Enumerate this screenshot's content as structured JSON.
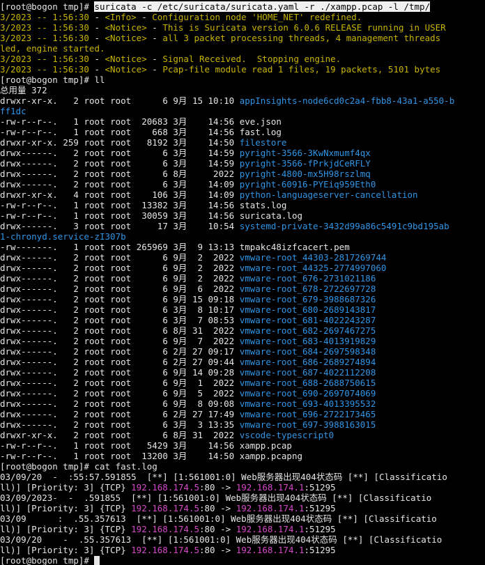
{
  "prompt": "[root@bogon tmp]# ",
  "command1": "suricata -c /etc/suricata/suricata.yaml -r ./xampp.pcap -l /tmp/",
  "suricata_output": [
    {
      "ts": "3/2023 -- 1:56:30",
      "tag": "<Info>",
      "msg": "Configuration node 'HOME_NET' redefined."
    },
    {
      "ts": "3/2023 -- 1:56:30",
      "tag": "<Notice>",
      "msg": "This is Suricata version 6.0.6 RELEASE running in USER"
    },
    {
      "ts": "3/2023 -- 1:56:30",
      "tag": "<Notice>",
      "msg": "all 3 packet processing threads, 4 management threads"
    },
    {
      "wrap": "led, engine started."
    },
    {
      "ts": "3/2023 -- 1:56:30",
      "tag": "<Notice>",
      "msg": "Signal Received.  Stopping engine."
    },
    {
      "ts": "3/2023 -- 1:56:30",
      "tag": "<Notice>",
      "msg": "Pcap-file module read 1 files, 19 packets, 5101 bytes"
    }
  ],
  "command2": "ll",
  "total_line": "总用量 372",
  "ls_rows": [
    {
      "perm": "drwxr-xr-x.",
      "links": "2",
      "size": "6",
      "month": "9月",
      "day": "15",
      "time": "10:10",
      "name": "appInsights-node6cd0c2a4-fbb8-43a1-a550-b",
      "dir": true
    },
    {
      "wrap": "ff1dc",
      "dir": true
    },
    {
      "perm": "-rw-r--r--.",
      "links": "1",
      "size": "20683",
      "month": "3月",
      "day": "",
      "time": "14:56",
      "name": "eve.json",
      "dir": false
    },
    {
      "perm": "-rw-r--r--.",
      "links": "1",
      "size": "668",
      "month": "3月",
      "day": "",
      "time": "14:56",
      "name": "fast.log",
      "dir": false
    },
    {
      "perm": "drwxr-xr-x.",
      "links": "259",
      "size": "8192",
      "month": "3月",
      "day": "",
      "time": "14:50",
      "name": "filestore",
      "dir": true
    },
    {
      "perm": "drwx------.",
      "links": "2",
      "size": "6",
      "month": "3月",
      "day": "",
      "time": "14:59",
      "name": "pyright-3566-3KwNxmumf4qx",
      "dir": true
    },
    {
      "perm": "drwx------.",
      "links": "2",
      "size": "6",
      "month": "3月",
      "day": "",
      "time": "14:59",
      "name": "pyright-3566-fPrkjdCeRFLY",
      "dir": true
    },
    {
      "perm": "drwx------.",
      "links": "2",
      "size": "6",
      "month": "8月",
      "day": "",
      "time": "2022",
      "name": "pyright-4800-mx5H98rszlmq",
      "dir": true
    },
    {
      "perm": "drwx------.",
      "links": "2",
      "size": "6",
      "month": "3月",
      "day": "",
      "time": "14:09",
      "name": "pyright-60916-PYEiq959Eth0",
      "dir": true
    },
    {
      "perm": "drwxr-xr-x.",
      "links": "4",
      "size": "106",
      "month": "3月",
      "day": "",
      "time": "14:09",
      "name": "python-languageserver-cancellation",
      "dir": true
    },
    {
      "perm": "-rw-r--r--.",
      "links": "1",
      "size": "13382",
      "month": "3月",
      "day": "",
      "time": "14:56",
      "name": "stats.log",
      "dir": false
    },
    {
      "perm": "-rw-r--r--.",
      "links": "1",
      "size": "30059",
      "month": "3月",
      "day": "",
      "time": "14:56",
      "name": "suricata.log",
      "dir": false
    },
    {
      "perm": "drwx------.",
      "links": "3",
      "size": "17",
      "month": "3月",
      "day": "",
      "time": "10:54",
      "name": "systemd-private-3432d99a86c5491c9bd195ab",
      "dir": true
    },
    {
      "wrap": "1-chronyd.service-zI307b",
      "dir": true
    },
    {
      "perm": "-rw-------.",
      "links": "1",
      "size": "265969",
      "month": "3月",
      "day": "9",
      "time": "13:13",
      "name": "tmpakc48izfcacert.pem",
      "dir": false
    },
    {
      "perm": "drwx------.",
      "links": "2",
      "size": "6",
      "month": "9月",
      "day": "2",
      "time": "2022",
      "name": "vmware-root_44303-2817269744",
      "dir": true
    },
    {
      "perm": "drwx------.",
      "links": "2",
      "size": "6",
      "month": "9月",
      "day": "2",
      "time": "2022",
      "name": "vmware-root_44325-2774997060",
      "dir": true
    },
    {
      "perm": "drwx------.",
      "links": "2",
      "size": "6",
      "month": "9月",
      "day": "2",
      "time": "2022",
      "name": "vmware-root_676-2731021186",
      "dir": true
    },
    {
      "perm": "drwx------.",
      "links": "2",
      "size": "6",
      "month": "9月",
      "day": "6",
      "time": "2022",
      "name": "vmware-root_678-2722697728",
      "dir": true
    },
    {
      "perm": "drwx------.",
      "links": "2",
      "size": "6",
      "month": "9月",
      "day": "15",
      "time": "09:18",
      "name": "vmware-root_679-3988687326",
      "dir": true
    },
    {
      "perm": "drwx------.",
      "links": "2",
      "size": "6",
      "month": "3月",
      "day": "8",
      "time": "10:17",
      "name": "vmware-root_680-2689143817",
      "dir": true
    },
    {
      "perm": "drwx------.",
      "links": "2",
      "size": "6",
      "month": "3月",
      "day": "7",
      "time": "08:53",
      "name": "vmware-root_681-4022243287",
      "dir": true
    },
    {
      "perm": "drwx------.",
      "links": "2",
      "size": "6",
      "month": "8月",
      "day": "31",
      "time": "2022",
      "name": "vmware-root_682-2697467275",
      "dir": true
    },
    {
      "perm": "drwx------.",
      "links": "2",
      "size": "6",
      "month": "9月",
      "day": "7",
      "time": "2022",
      "name": "vmware-root_683-4013919829",
      "dir": true
    },
    {
      "perm": "drwx------.",
      "links": "2",
      "size": "6",
      "month": "2月",
      "day": "27",
      "time": "09:17",
      "name": "vmware-root_684-2697598348",
      "dir": true
    },
    {
      "perm": "drwx------.",
      "links": "2",
      "size": "6",
      "month": "2月",
      "day": "27",
      "time": "09:44",
      "name": "vmware-root_686-2689274894",
      "dir": true
    },
    {
      "perm": "drwx------.",
      "links": "2",
      "size": "6",
      "month": "9月",
      "day": "14",
      "time": "09:28",
      "name": "vmware-root_687-4022112208",
      "dir": true
    },
    {
      "perm": "drwx------.",
      "links": "2",
      "size": "6",
      "month": "9月",
      "day": "1",
      "time": "2022",
      "name": "vmware-root_688-2688750615",
      "dir": true
    },
    {
      "perm": "drwx------.",
      "links": "2",
      "size": "6",
      "month": "9月",
      "day": "5",
      "time": "2022",
      "name": "vmware-root_690-2697074069",
      "dir": true
    },
    {
      "perm": "drwx------.",
      "links": "2",
      "size": "6",
      "month": "9月",
      "day": "8",
      "time": "09:08",
      "name": "vmware-root_693-4013395532",
      "dir": true
    },
    {
      "perm": "drwx------.",
      "links": "2",
      "size": "6",
      "month": "2月",
      "day": "27",
      "time": "17:49",
      "name": "vmware-root_696-2722173465",
      "dir": true
    },
    {
      "perm": "drwx------.",
      "links": "2",
      "size": "6",
      "month": "3月",
      "day": "3",
      "time": "13:35",
      "name": "vmware-root_697-3988163015",
      "dir": true
    },
    {
      "perm": "drwxr-xr-x.",
      "links": "2",
      "size": "6",
      "month": "8月",
      "day": "31",
      "time": "2022",
      "name": "vscode-typescript0",
      "dir": true
    },
    {
      "perm": "-rw-r--r--.",
      "links": "1",
      "size": "5429",
      "month": "3月",
      "day": "",
      "time": "14:56",
      "name": "xampp.pcap",
      "dir": false
    },
    {
      "perm": "-rw-r--r--.",
      "links": "1",
      "size": "13200",
      "month": "3月",
      "day": "",
      "time": "14:50",
      "name": "xampp.pcapng",
      "dir": false
    }
  ],
  "owner": "root",
  "group": "root",
  "command3": "cat fast.log",
  "fast_log": [
    {
      "a": "03/09/20  -  :55:57.591855  [**] [1:561001:0] Web服务器出现404状态码 [**] [Classificatio",
      "b": "ll)] [Priority: 3] {TCP} ",
      "src": "192.168.174.5",
      "port1": ":80 -> ",
      "dst": "192.168.174.1",
      "port2": ":51295"
    },
    {
      "a": "03/09/2023-  -  .591855  [**] [1:561001:0] Web服务器出现404状态码 [**] [Classificatio",
      "b": "ll)] [Priority: 3] {TCP} ",
      "src": "192.168.174.5",
      "port1": ":80 -> ",
      "dst": "192.168.174.1",
      "port2": ":51295"
    },
    {
      "a": "03/09      :  .55.357613  [**] [1:561001:0] Web服务器出现404状态码 [**] [Classificatio",
      "b": "ll)] [Priority: 3] {TCP} ",
      "src": "192.168.174.5",
      "port1": ":80 -> ",
      "dst": "192.168.174.1",
      "port2": ":51295"
    },
    {
      "a": "03/09/20    -  .55.357613  [**] [1:561001:0] Web服务器出现404状态码 [**] [Classificatio",
      "b": "ll)] [Priority: 3] {TCP} ",
      "src": "192.168.174.5",
      "port1": ":80 -> ",
      "dst": "192.168.174.1",
      "port2": ":51295"
    }
  ]
}
